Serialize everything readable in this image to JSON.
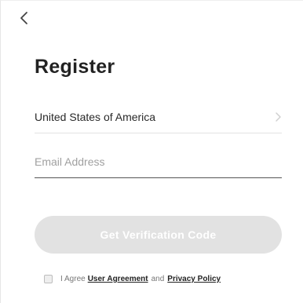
{
  "header": {
    "back_icon": "chevron-left-icon",
    "title": "Register"
  },
  "form": {
    "country": {
      "label": "United States of America",
      "chevron_icon": "chevron-right-icon"
    },
    "email": {
      "value": "",
      "placeholder": "Email Address"
    },
    "submit_label": "Get Verification Code"
  },
  "agreement": {
    "checked": false,
    "prefix": "I Agree",
    "user_agreement": "User Agreement",
    "conjunction": "and",
    "privacy_policy": "Privacy Policy"
  },
  "colors": {
    "title": "#222222",
    "button_disabled": "#e2e2e2",
    "link": "#222222"
  }
}
